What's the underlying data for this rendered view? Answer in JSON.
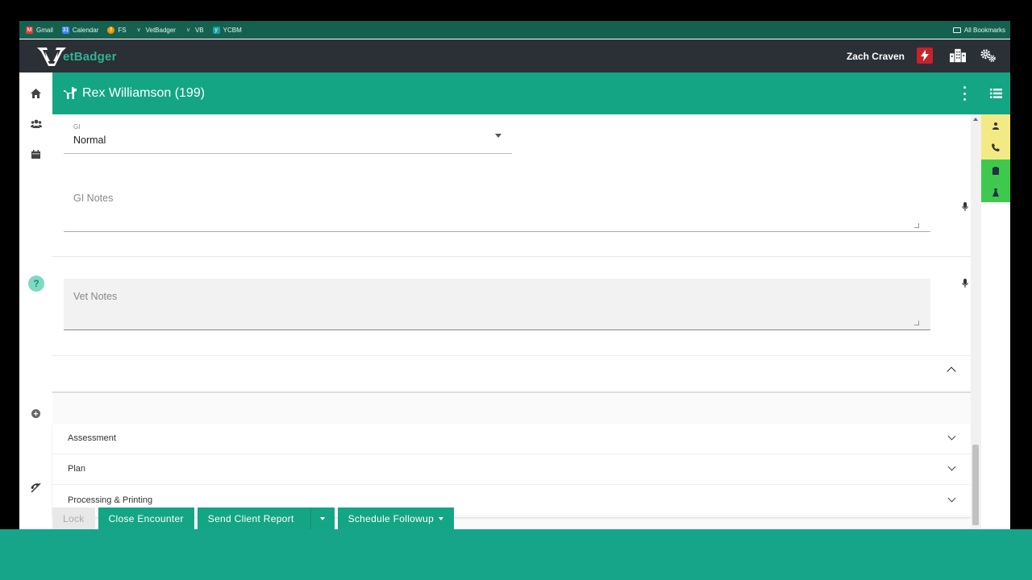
{
  "bookmarks": {
    "items": [
      {
        "label": "Gmail",
        "icon": "gmail-icon",
        "color": "#d44638"
      },
      {
        "label": "Calendar",
        "icon": "calendar-icon",
        "color": "#4285f4"
      },
      {
        "label": "FS",
        "icon": "fs-icon",
        "color": "#f29900"
      },
      {
        "label": "VetBadger",
        "icon": "vetbadger-icon",
        "color": "#333333"
      },
      {
        "label": "VB",
        "icon": "vb-icon",
        "color": "#333333"
      },
      {
        "label": "YCBM",
        "icon": "ycbm-icon",
        "color": "#1aa1a1"
      }
    ],
    "all_bookmarks": "All Bookmarks"
  },
  "app": {
    "logo_text": "etBadger",
    "user_name": "Zach Craven",
    "accent": "#14a585"
  },
  "patient": {
    "name": "Rex Williamson (199)"
  },
  "form": {
    "gi_label": "GI",
    "gi_value": "Normal",
    "gi_notes_placeholder": "GI Notes",
    "vet_notes_placeholder": "Vet Notes"
  },
  "accordion": {
    "items": [
      "Assessment",
      "Plan",
      "Processing & Printing"
    ]
  },
  "buttons": {
    "lock": "Lock",
    "close_encounter": "Close Encounter",
    "send_client_report": "Send Client Report",
    "schedule_followup": "Schedule Followup"
  }
}
